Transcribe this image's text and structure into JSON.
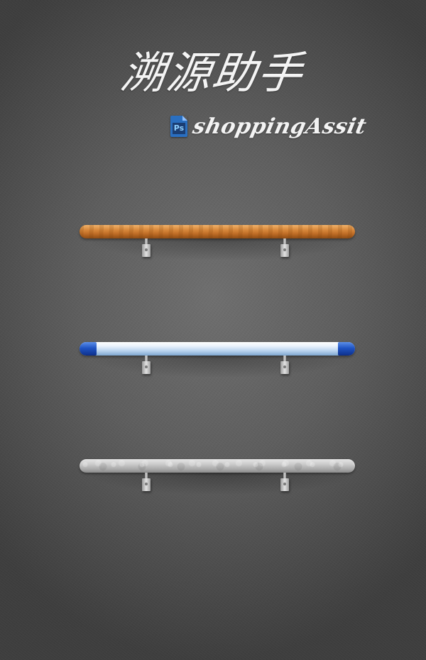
{
  "header": {
    "title": "溯源助手",
    "subtitle": "shoppingAssit",
    "subtitle_icon": "photoshop-file-icon",
    "subtitle_icon_text": "Ps"
  },
  "shelves": [
    {
      "name": "wood-shelf",
      "material": "wood",
      "color": "#d98a3d"
    },
    {
      "name": "blue-shelf",
      "material": "blue-white",
      "color": "#1f54c4"
    },
    {
      "name": "stone-shelf",
      "material": "stone",
      "color": "#c9c9c9"
    }
  ],
  "colors": {
    "background": "#5e5e5e",
    "title_text": "#f4f4f4"
  }
}
